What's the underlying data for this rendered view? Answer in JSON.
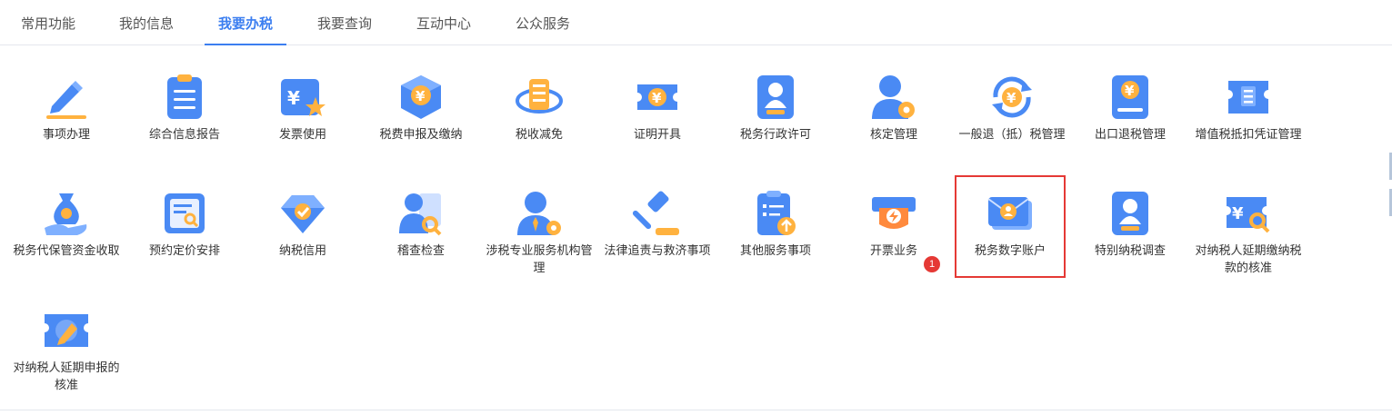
{
  "tabs": [
    {
      "label": "常用功能",
      "active": false
    },
    {
      "label": "我的信息",
      "active": false
    },
    {
      "label": "我要办税",
      "active": true
    },
    {
      "label": "我要查询",
      "active": false
    },
    {
      "label": "互动中心",
      "active": false
    },
    {
      "label": "公众服务",
      "active": false
    }
  ],
  "items": [
    {
      "label": "事项办理",
      "icon": "pencil-icon"
    },
    {
      "label": "综合信息报告",
      "icon": "clipboard-icon"
    },
    {
      "label": "发票使用",
      "icon": "invoice-star-icon"
    },
    {
      "label": "税费申报及缴纳",
      "icon": "yuan-cube-icon"
    },
    {
      "label": "税收减免",
      "icon": "tax-reduction-icon"
    },
    {
      "label": "证明开具",
      "icon": "yuan-ticket-icon"
    },
    {
      "label": "税务行政许可",
      "icon": "person-certificate-icon"
    },
    {
      "label": "核定管理",
      "icon": "person-gear-icon"
    },
    {
      "label": "一般退（抵）税管理",
      "icon": "yuan-refresh-icon"
    },
    {
      "label": "出口退税管理",
      "icon": "yuan-book-icon"
    },
    {
      "label": "增值税抵扣凭证管理",
      "icon": "vat-ticket-icon"
    },
    {
      "label": "税务代保管资金收取",
      "icon": "money-bag-hand-icon"
    },
    {
      "label": "预约定价安排",
      "icon": "document-search-icon"
    },
    {
      "label": "纳税信用",
      "icon": "diamond-check-icon"
    },
    {
      "label": "稽查检查",
      "icon": "person-inspect-icon"
    },
    {
      "label": "涉税专业服务机构管理",
      "icon": "person-gear-tie-icon"
    },
    {
      "label": "法律追责与救济事项",
      "icon": "gavel-icon"
    },
    {
      "label": "其他服务事项",
      "icon": "clipboard-upload-icon"
    },
    {
      "label": "开票业务",
      "icon": "printer-lightning-icon"
    },
    {
      "label": "税务数字账户",
      "icon": "envelope-user-icon"
    },
    {
      "label": "特别纳税调查",
      "icon": "person-card-icon"
    },
    {
      "label": "对纳税人延期缴纳税款的核准",
      "icon": "yuan-search-ticket-icon"
    },
    {
      "label": "对纳税人延期申报的核准",
      "icon": "pencil-ticket-icon"
    }
  ],
  "badge": {
    "count": "1"
  },
  "colors": {
    "accent": "#3b7ef0",
    "highlight": "#e53935",
    "icon_primary": "#4a8af4",
    "icon_secondary": "#ffb23f"
  }
}
